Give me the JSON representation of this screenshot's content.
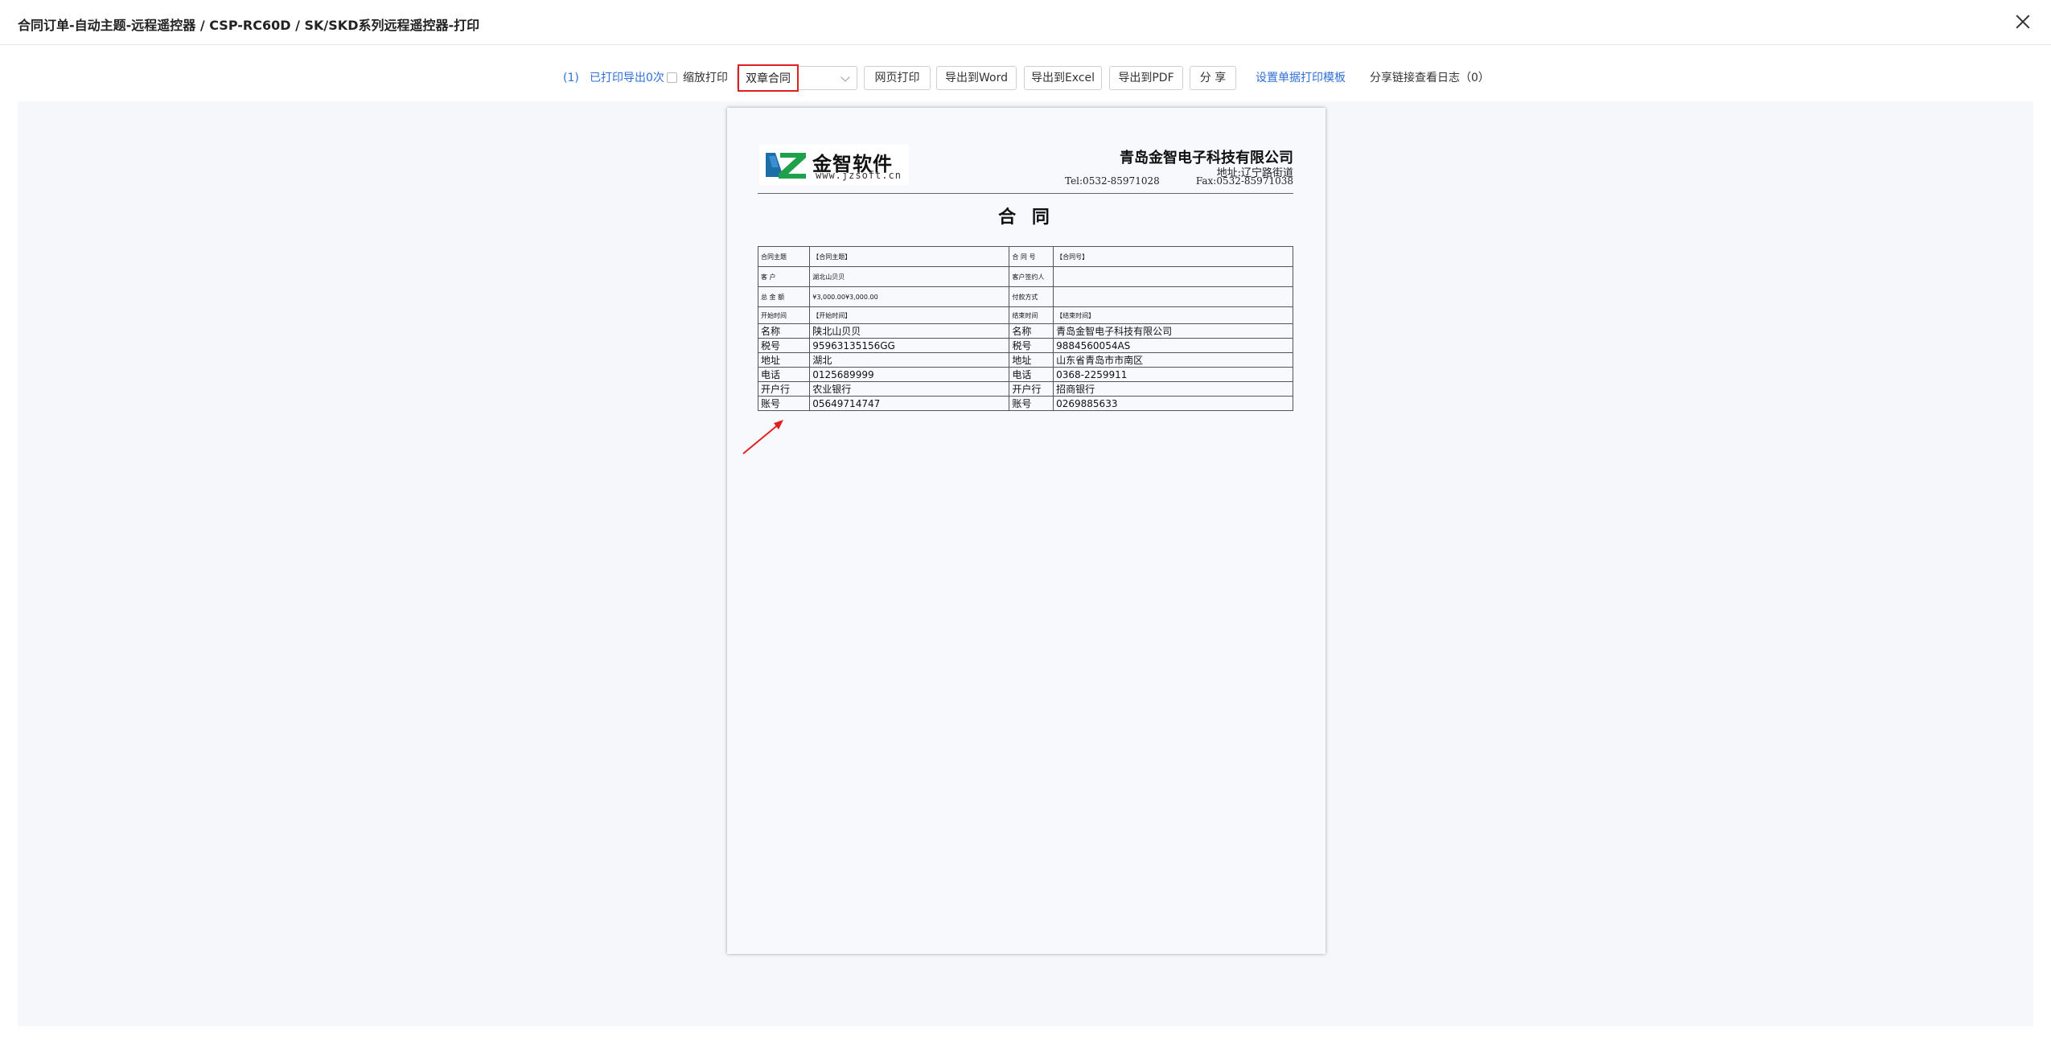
{
  "window": {
    "title": "合同订单-自动主题-远程遥控器 / CSP-RC60D / SK/SKD系列远程遥控器-打印"
  },
  "toolbar": {
    "count_link": "(1)",
    "printed_status": "已打印导出0次",
    "zoom_print_label": "缩放打印",
    "template_select": "双章合同",
    "web_print": "网页打印",
    "export_word": "导出到Word",
    "export_excel": "导出到Excel",
    "export_pdf": "导出到PDF",
    "share": "分 享",
    "template_settings": "设置单据打印模板",
    "share_log": "分享链接查看日志（0）"
  },
  "document": {
    "logo_cn": "金智软件",
    "logo_url": "www.jzsoft.cn",
    "company": "青岛金智电子科技有限公司",
    "address": "地址:辽宁路街道",
    "tel": "Tel:0532-85971028",
    "fax": "Fax:0532-85971038",
    "title": "合 同",
    "rows": [
      [
        "合同主题",
        "【合同主题】",
        "合  同  号",
        "【合同号】"
      ],
      [
        "客  户",
        "湖北山贝贝",
        "客户签约人",
        ""
      ],
      [
        "总 金 额",
        "¥3,000.00¥3,000.00",
        "付款方式",
        ""
      ],
      [
        "开始时间",
        "【开始时间】",
        "结束时间",
        "【结束时间】"
      ],
      [
        "名称",
        "陕北山贝贝",
        "名称",
        "青岛金智电子科技有限公司"
      ],
      [
        "税号",
        "95963135156GG",
        "税号",
        "9884560054AS"
      ],
      [
        "地址",
        "湖北",
        "地址",
        "山东省青岛市市南区"
      ],
      [
        "电话",
        "0125689999",
        "电话",
        "0368-2259911"
      ],
      [
        "开户行",
        "农业银行",
        "开户行",
        "招商银行"
      ],
      [
        "账号",
        "05649714747",
        "账号",
        "0269885633"
      ]
    ]
  },
  "colors": {
    "accent": "#2f6fd6",
    "highlight": "#e02020",
    "canvas": "#f5f7fb"
  }
}
